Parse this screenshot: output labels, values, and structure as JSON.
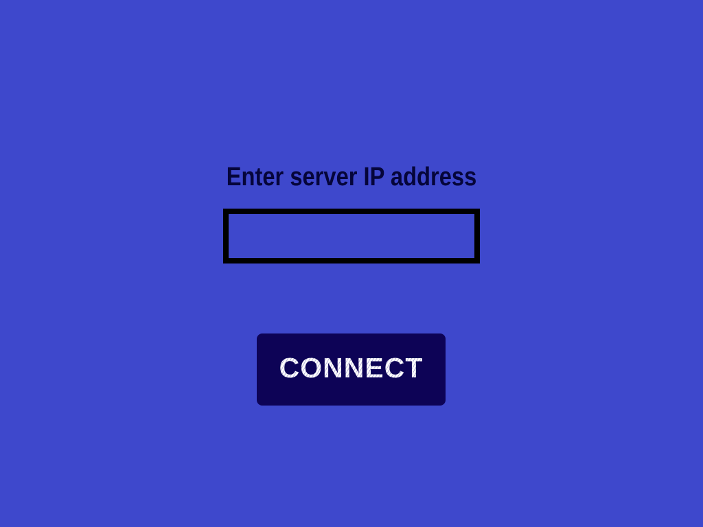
{
  "prompt": {
    "label": "Enter server IP address"
  },
  "ip_field": {
    "value": "",
    "placeholder": ""
  },
  "connect_button": {
    "label": "CONNECT"
  },
  "colors": {
    "background": "#3e48cc",
    "text": "#05053a",
    "input_border": "#000000",
    "button_background": "#0d0356",
    "button_text": "#ffffff"
  }
}
